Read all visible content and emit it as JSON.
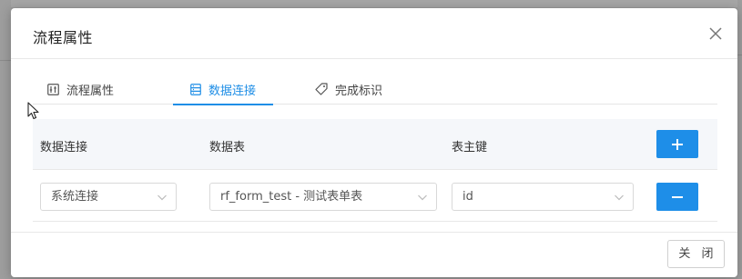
{
  "modal": {
    "title": "流程属性"
  },
  "tabs": [
    {
      "label": "流程属性",
      "icon": "sliders-icon",
      "active": false
    },
    {
      "label": "数据连接",
      "icon": "database-icon",
      "active": true
    },
    {
      "label": "完成标识",
      "icon": "tag-icon",
      "active": false
    }
  ],
  "table": {
    "columns": [
      "数据连接",
      "数据表",
      "表主键"
    ],
    "rows": [
      {
        "connection": "系统连接",
        "table": "rf_form_test - 测试表单表",
        "primary_key": "id"
      }
    ]
  },
  "footer": {
    "close_label": "关 闭"
  },
  "colors": {
    "accent": "#1f8ee6",
    "button": "#1e8ee8"
  }
}
